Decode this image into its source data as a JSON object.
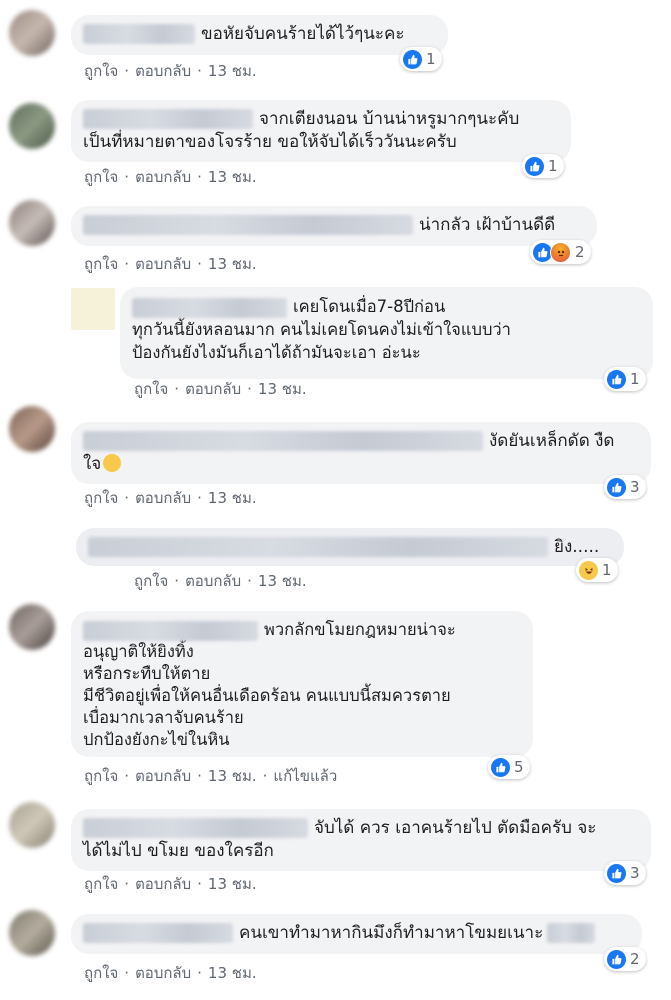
{
  "actions": {
    "like": "ถูกใจ",
    "reply": "ตอบกลับ",
    "dot": "·",
    "time": "13 ชม.",
    "edited": "แก้ไขแล้ว"
  },
  "comments": [
    {
      "lines": [
        "ขอหัยจับคนร้ายได้ไว้ๆนะคะ"
      ],
      "reactions": "1"
    },
    {
      "lines": [
        "จากเตียงนอน บ้านน่าหรูมากๆนะคับ",
        "เป็นที่หมายตาของโจรร้าย ขอให้จับได้เร็ววันนะครับ"
      ],
      "reactions": "1"
    },
    {
      "lines": [
        "น่ากลัว เฝ้าบ้านดีดี"
      ],
      "reactions": "2"
    },
    {
      "lines": [
        "เคยโดนเมื่อ7-8ปีก่อน",
        "ทุกวันนี้ยังหลอนมาก คนไม่เคยโดนคงไม่เข้าใจแบบว่า",
        "ป้องกันยังไงมันก็เอาได้ถ้ามันจะเอา อ่ะนะ"
      ],
      "reactions": "1"
    },
    {
      "lines": [
        "งัดยันเหล็กดัด งืด",
        "ใจ"
      ],
      "reactions": "3"
    },
    {
      "lines": [
        "ยิง....."
      ],
      "reactions": "1"
    },
    {
      "lines": [
        "พวกลักขโมยกฎหมายน่าจะ",
        "อนุญาติให้ยิงทิ้ง",
        "หรือกระทืบให้ตาย",
        "มีชีวิตอยู่เพื่อให้คนอื่นเดือดร้อน คนแบบนี้สมควรตาย",
        "เบื่อมากเวลาจับคนร้าย",
        "ปกป้องยังกะไข่ในหิน"
      ],
      "reactions": "5"
    },
    {
      "lines": [
        "จับได้ ควร เอาคนร้ายไป ตัดมือครับ จะ",
        "ได้ไม่ไป ขโมย ของใครอีก"
      ],
      "reactions": "3"
    },
    {
      "lines": [
        "คนเขาทำมาหากินมึงก็ทำมาหาโขมยเนาะ"
      ],
      "reactions": "2"
    }
  ],
  "colors": {
    "like_blue": "#1877f2",
    "bubble_bg": "#f2f3f5",
    "meta_gray": "#606770"
  }
}
